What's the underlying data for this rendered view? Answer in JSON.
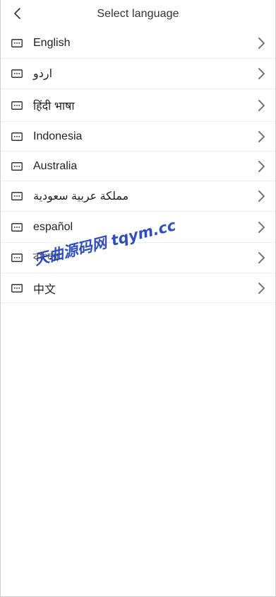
{
  "header": {
    "title": "Select language"
  },
  "languages": [
    {
      "label": "English"
    },
    {
      "label": "اردو"
    },
    {
      "label": "हिंदी भाषा"
    },
    {
      "label": "Indonesia"
    },
    {
      "label": "Australia"
    },
    {
      "label": "مملكة عربية سعودية"
    },
    {
      "label": "español"
    },
    {
      "label": "বাংলা"
    },
    {
      "label": "中文"
    }
  ],
  "watermark": {
    "text": "天曲源码网 tqym.cc",
    "color": "#1f3fb8"
  },
  "icons": {
    "back": "chevron-left-icon",
    "language": "language-keyboard-icon",
    "row_arrow": "chevron-right-icon"
  }
}
